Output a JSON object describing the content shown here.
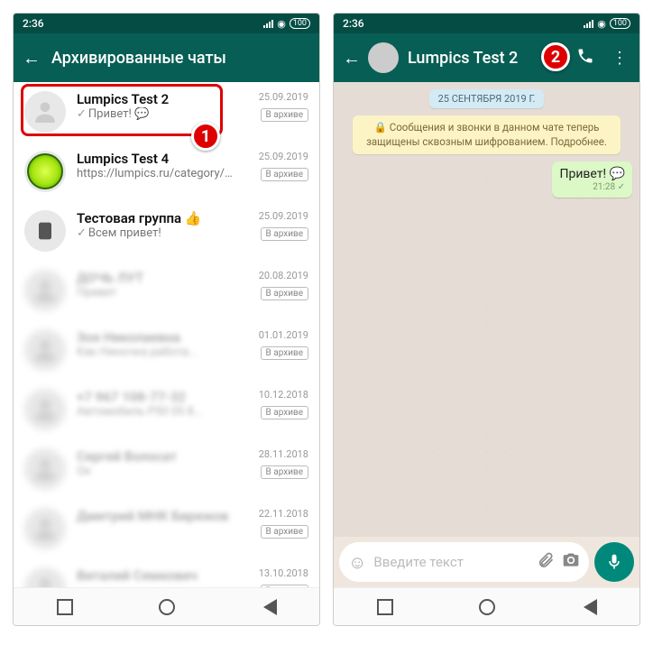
{
  "status": {
    "time": "2:36",
    "battery": "100"
  },
  "left": {
    "header_title": "Архивированные чаты",
    "callout": "1",
    "archived_label": "В архиве",
    "chats": [
      {
        "name": "Lumpics Test 2",
        "msg": "Привет! 💬",
        "date": "25.09.2019",
        "tick": true,
        "avatar": "default"
      },
      {
        "name": "Lumpics Test 4",
        "msg": "https://lumpics.ru/category/w...",
        "date": "25.09.2019",
        "tick": false,
        "avatar": "lime"
      },
      {
        "name": "Тестовая группа 👍",
        "msg": "Всем привет!",
        "date": "25.09.2019",
        "tick": true,
        "avatar": "dark"
      },
      {
        "name": "ДОЧЬ ЛУТ",
        "msg": "Привет",
        "date": "20.08.2019",
        "blur": true
      },
      {
        "name": "Зоя Николаевна",
        "msg": "Как Ниночка работа...",
        "date": "01.01.2019",
        "blur": true
      },
      {
        "name": "+7 967 108-77-32",
        "msg": "Автомобиль P50 05 8...",
        "date": "10.12.2018",
        "blur": true
      },
      {
        "name": "Сергей Волосат",
        "msg": "Ок",
        "date": "28.11.2018",
        "blur": true
      },
      {
        "name": "Дмитрий МНК Бирюков",
        "msg": " ",
        "date": "22.11.2018",
        "blur": true
      },
      {
        "name": "Виталий Семкович",
        "msg": " ",
        "date": "13.10.2018",
        "blur": true
      }
    ]
  },
  "right": {
    "chat_title": "Lumpics Test 2",
    "callout": "2",
    "date_pill": "25 СЕНТЯБРЯ 2019 Г.",
    "encryption_notice": "🔒 Сообщения и звонки в данном чате теперь защищены сквозным шифрованием. Подробнее.",
    "bubble_text": "Привет! 💬",
    "bubble_time": "21:28",
    "input_placeholder": "Введите текст"
  }
}
